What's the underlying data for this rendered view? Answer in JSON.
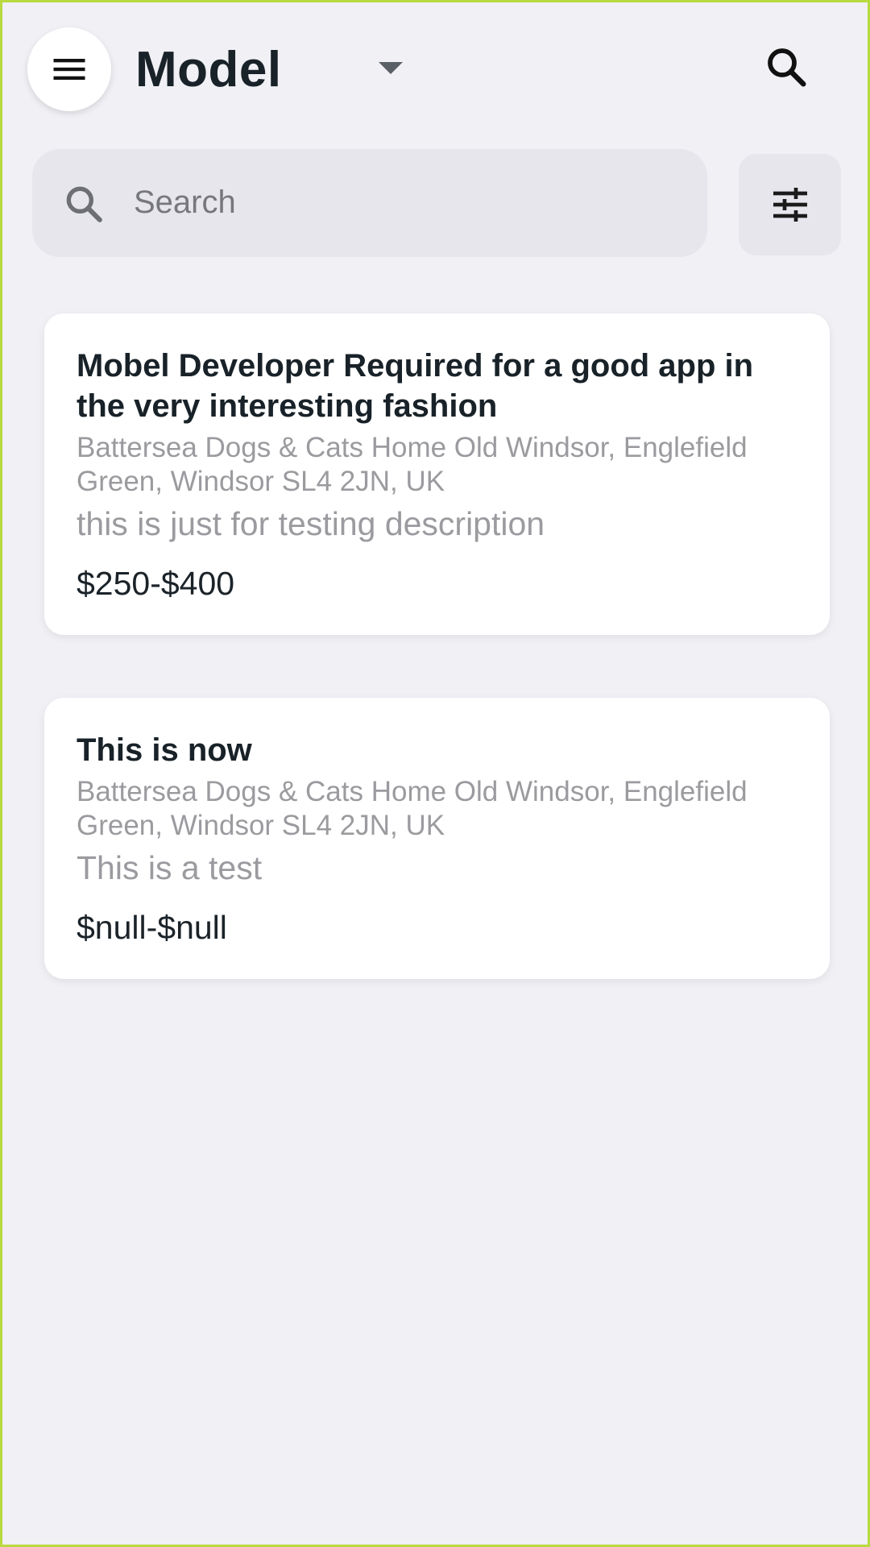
{
  "header": {
    "title": "Model",
    "menu_icon": "hamburger-menu-icon",
    "dropdown_icon": "caret-down-icon",
    "search_icon": "search-icon"
  },
  "search": {
    "placeholder": "Search",
    "value": "",
    "icon": "search-icon"
  },
  "filter": {
    "icon": "tune-sliders-icon"
  },
  "jobs": [
    {
      "title": "Mobel Developer Required for a good app in the very interesting fashion",
      "location": "Battersea Dogs & Cats Home Old Windsor, Englefield Green, Windsor SL4 2JN, UK",
      "description": "this is just for testing description",
      "price": "$250-$400"
    },
    {
      "title": "This is now",
      "location": "Battersea Dogs & Cats Home Old Windsor, Englefield Green, Windsor SL4 2JN, UK",
      "description": "This is a test",
      "price": "$null-$null"
    }
  ],
  "colors": {
    "background": "#f0f0f5",
    "card": "#ffffff",
    "search_bg": "#e6e6ec",
    "title_text": "#182228",
    "muted_text": "#9b9b9f",
    "frame_border": "#b8d93f"
  }
}
